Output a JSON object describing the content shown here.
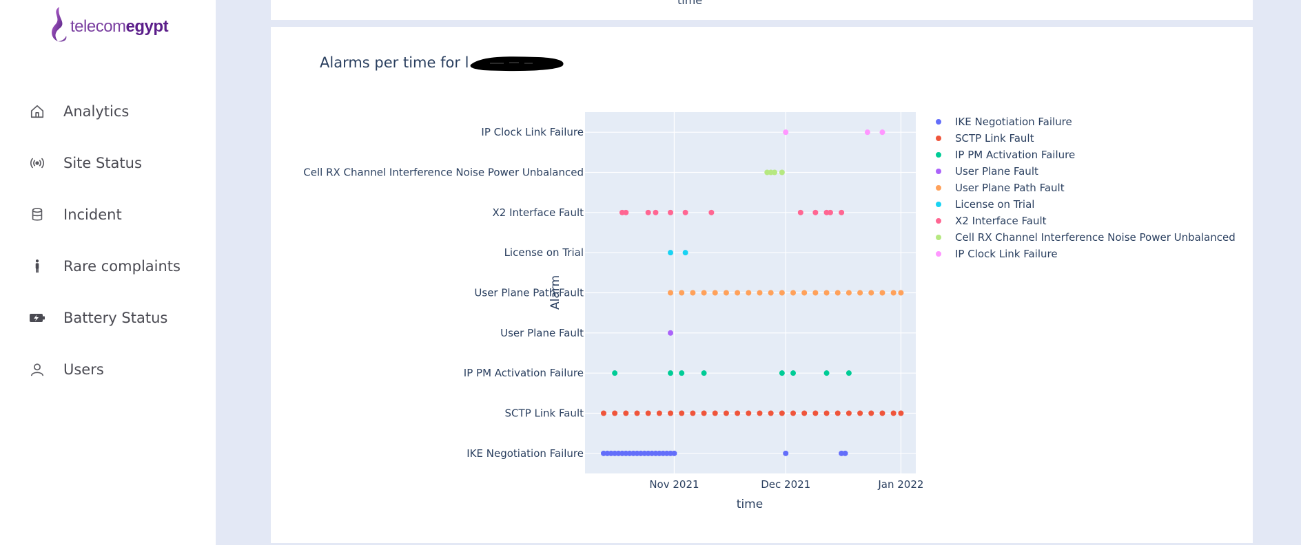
{
  "app": {
    "logo_part1": "telecom",
    "logo_part2": "egypt"
  },
  "sidebar": {
    "items": [
      {
        "label": "Analytics",
        "icon": "home-icon"
      },
      {
        "label": "Site Status",
        "icon": "broadcast-icon"
      },
      {
        "label": "Incident",
        "icon": "database-icon"
      },
      {
        "label": "Rare complaints",
        "icon": "person-standing-icon"
      },
      {
        "label": "Battery Status",
        "icon": "battery-charging-icon"
      },
      {
        "label": "Users",
        "icon": "user-icon"
      }
    ]
  },
  "top_panel": {
    "xlabel_cut": "time"
  },
  "chart_data": {
    "type": "scatter",
    "title_prefix": "Alarms per time for",
    "xlabel": "time",
    "ylabel": "Alarm",
    "xlim": [
      "2021-10-08",
      "2022-01-05"
    ],
    "x_ticks": [
      {
        "date": "2021-11-01",
        "label": "Nov 2021"
      },
      {
        "date": "2021-12-01",
        "label": "Dec 2021"
      },
      {
        "date": "2022-01-01",
        "label": "Jan 2022"
      }
    ],
    "categories": [
      "IKE Negotiation Failure",
      "SCTP Link Fault",
      "IP PM Activation Failure",
      "User Plane Fault",
      "User Plane Path Fault",
      "License on Trial",
      "X2 Interface Fault",
      "Cell RX Channel Interference Noise Power Unbalanced",
      "IP Clock Link Failure"
    ],
    "grid": true,
    "legend_position": "right",
    "series": [
      {
        "name": "IKE Negotiation Failure",
        "color": "#636efa",
        "points": [
          "2021-10-13",
          "2021-10-14",
          "2021-10-15",
          "2021-10-16",
          "2021-10-17",
          "2021-10-18",
          "2021-10-19",
          "2021-10-20",
          "2021-10-21",
          "2021-10-22",
          "2021-10-23",
          "2021-10-24",
          "2021-10-25",
          "2021-10-26",
          "2021-10-27",
          "2021-10-28",
          "2021-10-29",
          "2021-10-30",
          "2021-10-31",
          "2021-11-01",
          "2021-12-01",
          "2021-12-16",
          "2021-12-17"
        ]
      },
      {
        "name": "SCTP Link Fault",
        "color": "#EF553B",
        "points": [
          "2021-10-13",
          "2021-10-16",
          "2021-10-19",
          "2021-10-22",
          "2021-10-25",
          "2021-10-28",
          "2021-10-31",
          "2021-11-03",
          "2021-11-06",
          "2021-11-09",
          "2021-11-12",
          "2021-11-15",
          "2021-11-18",
          "2021-11-21",
          "2021-11-24",
          "2021-11-27",
          "2021-11-30",
          "2021-12-03",
          "2021-12-06",
          "2021-12-09",
          "2021-12-12",
          "2021-12-15",
          "2021-12-18",
          "2021-12-21",
          "2021-12-24",
          "2021-12-27",
          "2021-12-30",
          "2022-01-01"
        ]
      },
      {
        "name": "IP PM Activation Failure",
        "color": "#00cc96",
        "points": [
          "2021-10-16",
          "2021-10-31",
          "2021-11-03",
          "2021-11-09",
          "2021-11-30",
          "2021-12-03",
          "2021-12-12",
          "2021-12-18"
        ]
      },
      {
        "name": "User Plane Fault",
        "color": "#ab63fa",
        "points": [
          "2021-10-31"
        ]
      },
      {
        "name": "User Plane Path Fault",
        "color": "#FFA15A",
        "points": [
          "2021-10-31",
          "2021-11-03",
          "2021-11-06",
          "2021-11-09",
          "2021-11-12",
          "2021-11-15",
          "2021-11-18",
          "2021-11-21",
          "2021-11-24",
          "2021-11-27",
          "2021-11-30",
          "2021-12-03",
          "2021-12-06",
          "2021-12-09",
          "2021-12-12",
          "2021-12-15",
          "2021-12-18",
          "2021-12-21",
          "2021-12-24",
          "2021-12-27",
          "2021-12-30",
          "2022-01-01"
        ]
      },
      {
        "name": "License on Trial",
        "color": "#19d3f3",
        "points": [
          "2021-10-31",
          "2021-11-04"
        ]
      },
      {
        "name": "X2 Interface Fault",
        "color": "#FF6692",
        "points": [
          "2021-10-18",
          "2021-10-19",
          "2021-10-25",
          "2021-10-27",
          "2021-10-31",
          "2021-11-04",
          "2021-11-11",
          "2021-12-05",
          "2021-12-09",
          "2021-12-12",
          "2021-12-13",
          "2021-12-16"
        ]
      },
      {
        "name": "Cell RX Channel Interference Noise Power Unbalanced",
        "color": "#B6E880",
        "points": [
          "2021-11-26",
          "2021-11-27",
          "2021-11-28",
          "2021-11-30"
        ]
      },
      {
        "name": "IP Clock Link Failure",
        "color": "#FF97FF",
        "points": [
          "2021-12-01",
          "2021-12-23",
          "2021-12-27"
        ]
      }
    ]
  }
}
